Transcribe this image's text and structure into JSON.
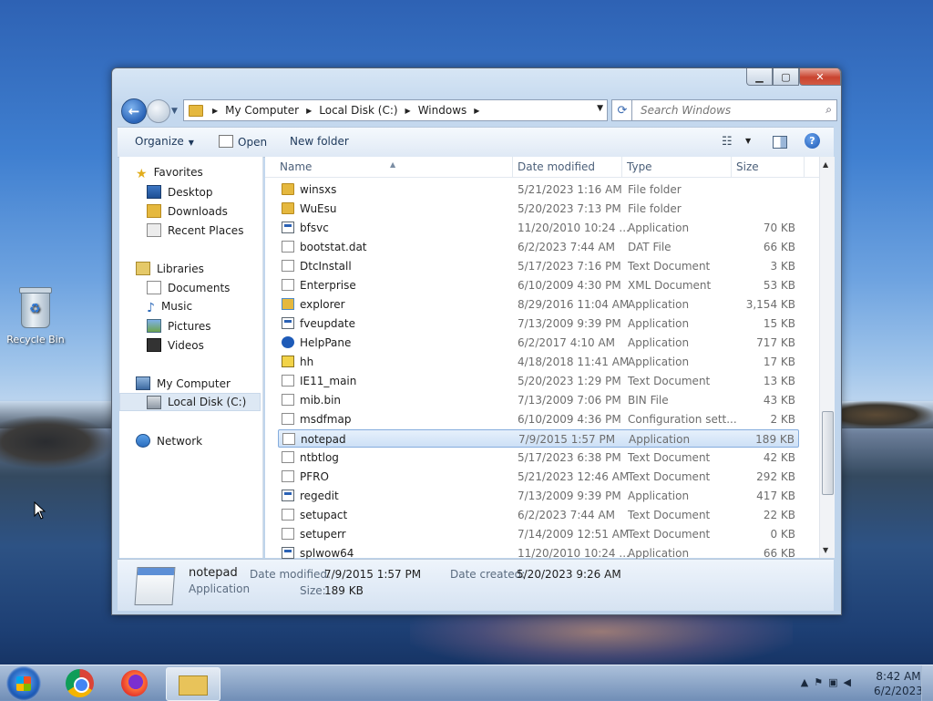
{
  "desktop": {
    "recycle_bin_label": "Recycle Bin"
  },
  "window": {
    "address": {
      "segments": [
        "My Computer",
        "Local Disk (C:)",
        "Windows"
      ]
    },
    "search": {
      "placeholder": "Search Windows"
    },
    "toolbar": {
      "organize": "Organize",
      "open": "Open",
      "new_folder": "New folder"
    },
    "nav": {
      "favorites": "Favorites",
      "desktop": "Desktop",
      "downloads": "Downloads",
      "recent_places": "Recent Places",
      "libraries": "Libraries",
      "documents": "Documents",
      "music": "Music",
      "pictures": "Pictures",
      "videos": "Videos",
      "my_computer": "My Computer",
      "local_disk": "Local Disk (C:)",
      "network": "Network"
    },
    "columns": {
      "name": "Name",
      "date": "Date modified",
      "type": "Type",
      "size": "Size"
    },
    "files": [
      {
        "name": "winsxs",
        "date": "5/21/2023 1:16 AM",
        "type": "File folder",
        "size": "",
        "icon": "folder-icon"
      },
      {
        "name": "WuEsu",
        "date": "5/20/2023 7:13 PM",
        "type": "File folder",
        "size": "",
        "icon": "folder-icon"
      },
      {
        "name": "bfsvc",
        "date": "11/20/2010 10:24 ...",
        "type": "Application",
        "size": "70 KB",
        "icon": "application-icon"
      },
      {
        "name": "bootstat.dat",
        "date": "6/2/2023 7:44 AM",
        "type": "DAT File",
        "size": "66 KB",
        "icon": "document-icon"
      },
      {
        "name": "DtcInstall",
        "date": "5/17/2023 7:16 PM",
        "type": "Text Document",
        "size": "3 KB",
        "icon": "document-icon"
      },
      {
        "name": "Enterprise",
        "date": "6/10/2009 4:30 PM",
        "type": "XML Document",
        "size": "53 KB",
        "icon": "document-icon"
      },
      {
        "name": "explorer",
        "date": "8/29/2016 11:04 AM",
        "type": "Application",
        "size": "3,154 KB",
        "icon": "explorer-icon"
      },
      {
        "name": "fveupdate",
        "date": "7/13/2009 9:39 PM",
        "type": "Application",
        "size": "15 KB",
        "icon": "application-icon"
      },
      {
        "name": "HelpPane",
        "date": "6/2/2017 4:10 AM",
        "type": "Application",
        "size": "717 KB",
        "icon": "help-icon"
      },
      {
        "name": "hh",
        "date": "4/18/2018 11:41 AM",
        "type": "Application",
        "size": "17 KB",
        "icon": "hh-icon"
      },
      {
        "name": "IE11_main",
        "date": "5/20/2023 1:29 PM",
        "type": "Text Document",
        "size": "13 KB",
        "icon": "document-icon"
      },
      {
        "name": "mib.bin",
        "date": "7/13/2009 7:06 PM",
        "type": "BIN File",
        "size": "43 KB",
        "icon": "document-icon"
      },
      {
        "name": "msdfmap",
        "date": "6/10/2009 4:36 PM",
        "type": "Configuration sett...",
        "size": "2 KB",
        "icon": "document-icon"
      },
      {
        "name": "notepad",
        "date": "7/9/2015 1:57 PM",
        "type": "Application",
        "size": "189 KB",
        "icon": "notepad-icon"
      },
      {
        "name": "ntbtlog",
        "date": "5/17/2023 6:38 PM",
        "type": "Text Document",
        "size": "42 KB",
        "icon": "document-icon"
      },
      {
        "name": "PFRO",
        "date": "5/21/2023 12:46 AM",
        "type": "Text Document",
        "size": "292 KB",
        "icon": "document-icon"
      },
      {
        "name": "regedit",
        "date": "7/13/2009 9:39 PM",
        "type": "Application",
        "size": "417 KB",
        "icon": "regedit-icon"
      },
      {
        "name": "setupact",
        "date": "6/2/2023 7:44 AM",
        "type": "Text Document",
        "size": "22 KB",
        "icon": "document-icon"
      },
      {
        "name": "setuperr",
        "date": "7/14/2009 12:51 AM",
        "type": "Text Document",
        "size": "0 KB",
        "icon": "document-icon"
      },
      {
        "name": "splwow64",
        "date": "11/20/2010 10:24 ...",
        "type": "Application",
        "size": "66 KB",
        "icon": "application-icon"
      }
    ],
    "selected_index": 13,
    "details": {
      "name": "notepad",
      "type": "Application",
      "date_modified_label": "Date modified:",
      "date_modified": "7/9/2015 1:57 PM",
      "size_label": "Size:",
      "size": "189 KB",
      "date_created_label": "Date created:",
      "date_created": "5/20/2023 9:26 AM"
    }
  },
  "taskbar": {
    "time": "8:42 AM",
    "date": "6/2/2023"
  }
}
